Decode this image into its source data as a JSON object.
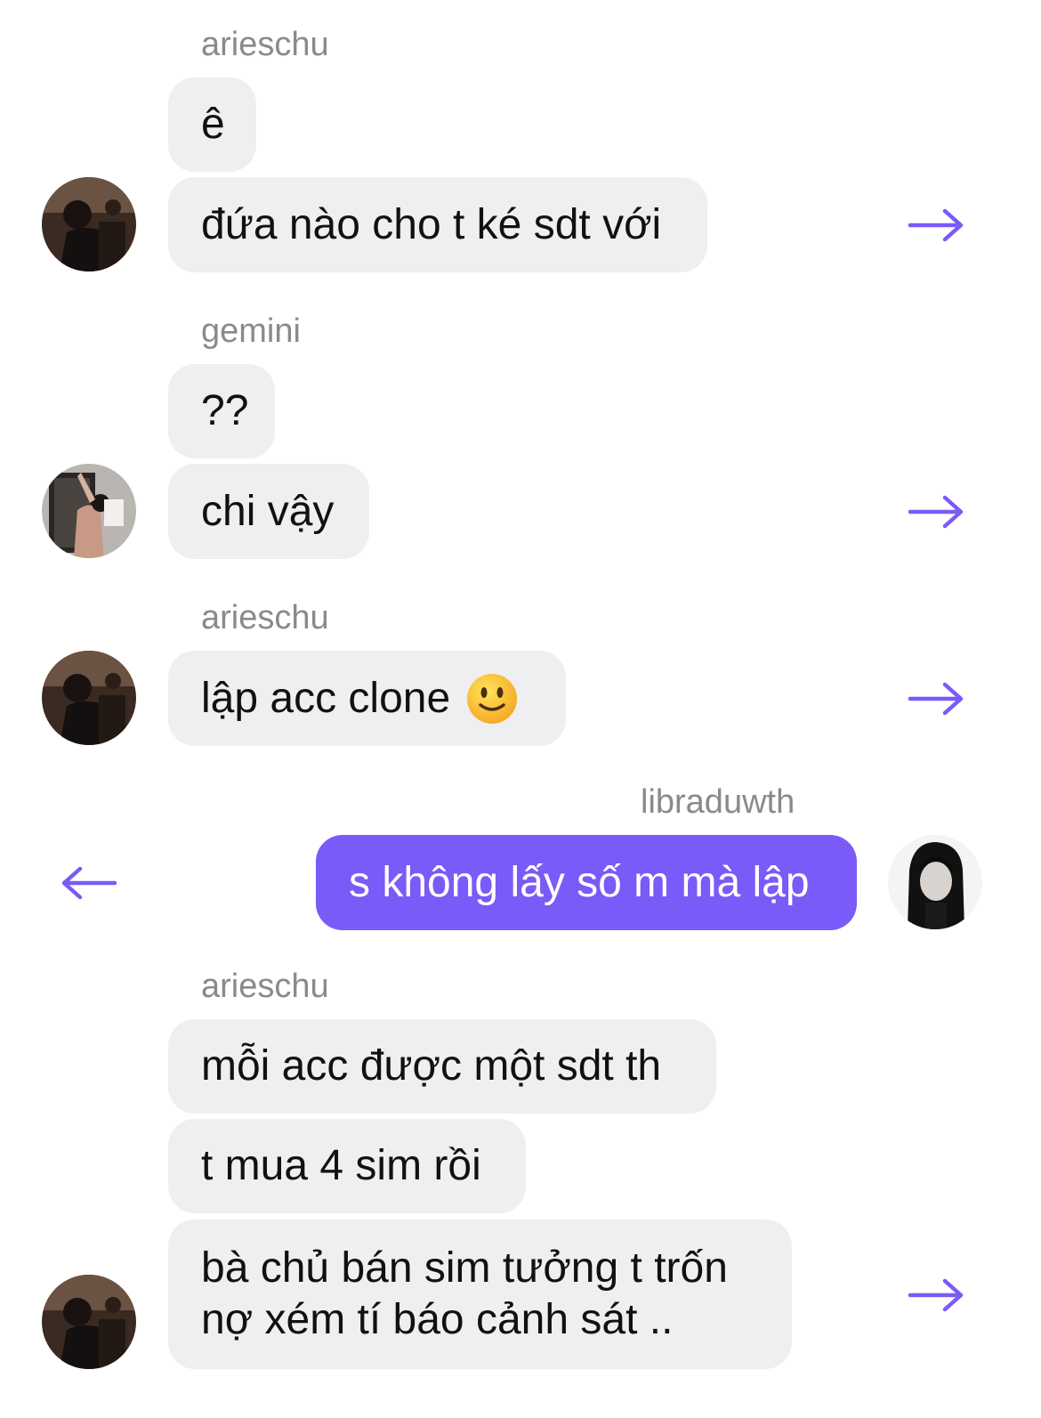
{
  "accent_color": "#7a5af8",
  "messages": [
    {
      "sender": "arieschu",
      "bubbles": [
        "ê",
        "đứa nào cho t ké sdt với"
      ]
    },
    {
      "sender": "gemini",
      "bubbles": [
        "??",
        "chi vậy"
      ]
    },
    {
      "sender": "arieschu",
      "bubbles": [
        "lập acc clone"
      ],
      "emoji": "slightly-smiling-face"
    },
    {
      "sender": "libraduwth",
      "bubbles": [
        "s không lấy số m mà lập"
      ]
    },
    {
      "sender": "arieschu",
      "bubbles": [
        "mỗi acc được một sdt th",
        "t mua 4 sim rồi",
        "bà chủ bán sim tưởng t trốn nợ xém tí báo cảnh sát .."
      ]
    }
  ],
  "icons": {
    "forward": "arrow-right-icon",
    "back": "arrow-left-icon"
  }
}
